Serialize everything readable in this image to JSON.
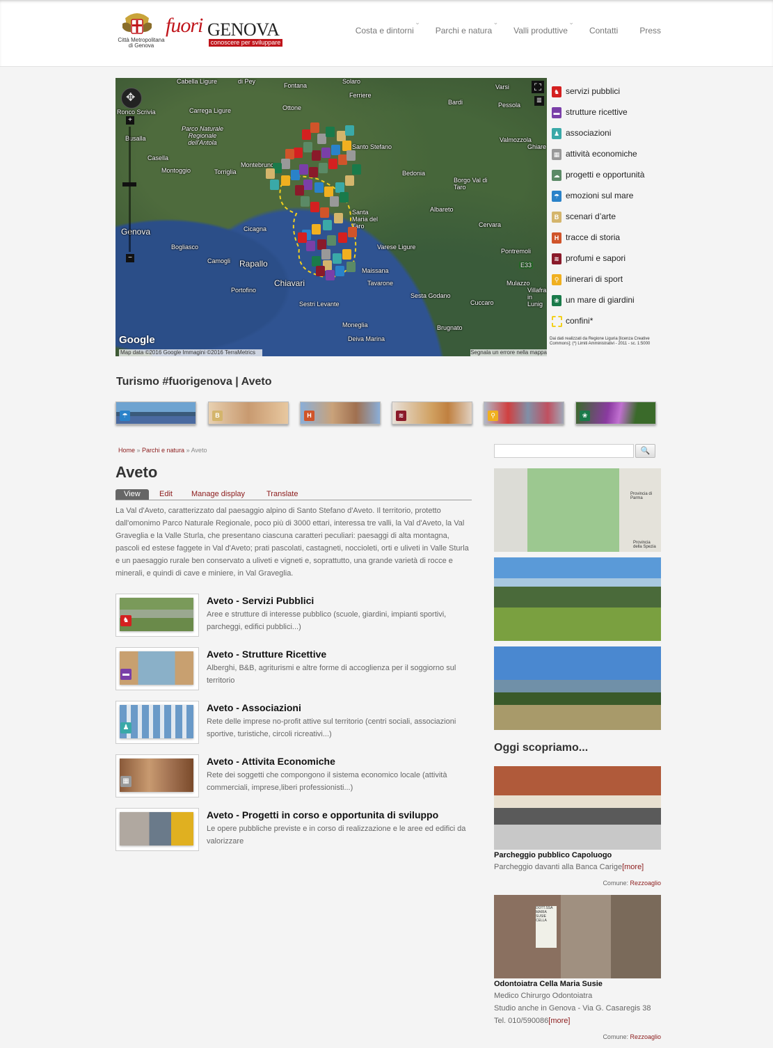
{
  "header": {
    "logo_caption": "Città Metropolitana di Genova",
    "brand_fuori": "fuori",
    "brand_genova": "GENOVA",
    "brand_tagline": "conoscere per sviluppare",
    "nav": [
      "Costa e dintorni",
      "Parchi e natura",
      "Valli produttive",
      "Contatti",
      "Press"
    ]
  },
  "map": {
    "labels_small": [
      "Cabella Ligure",
      "di Pey",
      "Fontana",
      "Ferriere",
      "Solaro",
      "Varsi",
      "Bardi",
      "Pessola",
      "Ronco Scrivia",
      "Carrega Ligure",
      "Ottone",
      "Busalla",
      "Parco Naturale Regionale dell'Antola",
      "Casella",
      "Montoggio",
      "Torriglia",
      "Montebruno",
      "Bedonia",
      "Borgo Val di Taro",
      "Valmozzola",
      "Ghiare",
      "Albareto",
      "Cervara",
      "Bogliasco",
      "Cicagna",
      "Camogli",
      "Portofino",
      "Varese Ligure",
      "Maissana",
      "Tavarone",
      "Sesta Godano",
      "Pontremoli",
      "Mulazzo",
      "Villafra in Lunig",
      "Cuccaro",
      "Moneglia",
      "Brugnato",
      "Deiva Marina",
      "Sestri Levante",
      "Santa Maria del Taro",
      "Santo Stefano"
    ],
    "labels_city": [
      "Genova",
      "Rapallo",
      "Chiavari"
    ],
    "footer": "Map data ©2016 Google Immagini ©2016 TerraMetrics",
    "footer_right": "Segnala un errore nella mappa",
    "google_logo": "Google",
    "zoom_in": "+",
    "zoom_out": "−",
    "road_label": "E33"
  },
  "legend": {
    "items": [
      {
        "label": "servizi pubblici",
        "color": "#d42020",
        "icon": "public-services-icon"
      },
      {
        "label": "strutture ricettive",
        "color": "#7a3fa8",
        "icon": "accommodation-icon"
      },
      {
        "label": "associazioni",
        "color": "#3aa9a8",
        "icon": "associations-icon"
      },
      {
        "label": "attività economiche",
        "color": "#999999",
        "icon": "economic-activities-icon"
      },
      {
        "label": "progetti e opportunità",
        "color": "#5b8a66",
        "icon": "projects-icon"
      },
      {
        "label": "emozioni sul mare",
        "color": "#2a82c9",
        "icon": "sea-emotions-icon"
      },
      {
        "label": "scenari d’arte",
        "color": "#d4b56c",
        "icon": "art-scenarios-icon"
      },
      {
        "label": "tracce di storia",
        "color": "#d0542a",
        "icon": "history-traces-icon"
      },
      {
        "label": "profumi e sapori",
        "color": "#8a1a2a",
        "icon": "flavours-icon"
      },
      {
        "label": "itinerari di sport",
        "color": "#f0b020",
        "icon": "sport-itineraries-icon"
      },
      {
        "label": "un mare di giardini",
        "color": "#1a7a4a",
        "icon": "gardens-icon"
      },
      {
        "label": "confini*",
        "color": "#f2d01e",
        "icon": "borders-icon"
      }
    ],
    "note": "Dai dati realizzati da Regione Liguria [licenza Creative Commons]; (*) Limiti Amministrativi - 2011 - sc. 1:5000"
  },
  "section_title": "Turismo #fuorigenova | Aveto",
  "breadcrumb": {
    "home": "Home",
    "sep": " » ",
    "parent": "Parchi e natura",
    "current": "Aveto"
  },
  "page": {
    "title": "Aveto",
    "tabs": [
      "View",
      "Edit",
      "Manage display",
      "Translate"
    ],
    "intro": "La Val d'Aveto, caratterizzato dal paesaggio alpino di Santo Stefano d'Aveto. Il territorio, protetto dall'omonimo Parco Naturale Regionale, poco più di 3000 ettari, interessa tre valli, la Val d'Aveto, la Val Graveglia e la Valle Sturla, che presentano ciascuna caratteri peculiari: paesaggi di alta montagna, pascoli ed estese faggete in Val d'Aveto; prati pascolati, castagneti, noccioleti, orti e uliveti in Valle Sturla e un paesaggio rurale ben conservato a uliveti e vigneti e, soprattutto, una grande varietà di rocce e minerali, e quindi di cave e miniere, in Val Graveglia."
  },
  "articles": [
    {
      "title": "Aveto - Servizi Pubblici",
      "desc": "Aree e strutture di interesse pubblico (scuole, giardini, impianti sportivi, parcheggi, edifici pubblici...)"
    },
    {
      "title": "Aveto - Strutture Ricettive",
      "desc": "Alberghi, B&B, agriturismi e altre forme di accoglienza per il soggiorno sul territorio"
    },
    {
      "title": "Aveto - Associazioni",
      "desc": "Rete delle imprese no-profit attive sul territorio (centri sociali, associazioni sportive, turistiche, circoli ricreativi...)"
    },
    {
      "title": "Aveto - Attivita Economiche",
      "desc": "Rete dei soggetti che compongono il sistema economico locale (attività commerciali, imprese,liberi professionisti...)"
    },
    {
      "title": "Aveto - Progetti in corso e opportunita di sviluppo",
      "desc": "Le opere pubbliche previste e in corso di realizzazione e le aree ed edifici da valorizzare"
    }
  ],
  "sidebar": {
    "search_button": "🔍",
    "map_labels": [
      "Provincia di Parma",
      "Provincia della Spezia"
    ],
    "heading": "Oggi scopriamo...",
    "pois": [
      {
        "title": "Parcheggio pubblico Capoluogo",
        "desc": "Parcheggio davanti alla Banca Carige",
        "more": "[more]",
        "comune_label": "Comune: ",
        "comune": "Rezzoaglio"
      },
      {
        "title": "Odontoiatra Cella Maria Susie",
        "desc1": "Medico Chirurgo Odontoiatra",
        "desc2": "Studio anche in Genova - Via G. Casaregis 38",
        "desc3": "Tel. 010/590086",
        "more": "[more]",
        "comune_label": "Comune: ",
        "comune": "Rezzoaglio",
        "sign": "DOTT.SSA MARIA SUSIE CELLA"
      }
    ]
  }
}
